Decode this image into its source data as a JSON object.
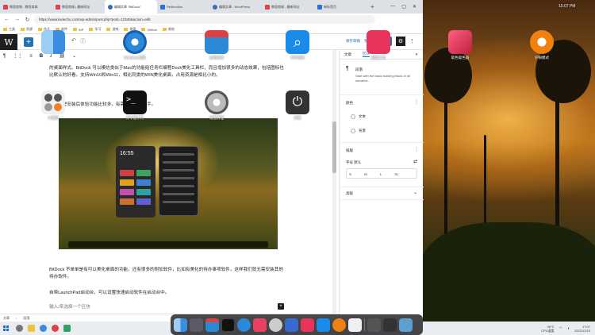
{
  "browser": {
    "tabs": [
      {
        "label": "教程商城 - 教程商城"
      },
      {
        "label": "教程商城 | 最新网址"
      },
      {
        "label": "编辑文章 “BitDock”"
      },
      {
        "label": "Redirection"
      },
      {
        "label": "编辑文章 - WordPress"
      },
      {
        "label": "教程商城 - 最新网址"
      },
      {
        "label": "新标签页"
      }
    ],
    "url": "https://www.kwiechu.com/wp-admin/post.php?post=12345&action=edit",
    "bookmarks": [
      "工具",
      "资源",
      "作品",
      "软件",
      "WP",
      "学习",
      "游戏",
      "常用",
      "GitHub",
      "其他"
    ]
  },
  "editor": {
    "save_draft": "保存草稿",
    "preview": "预览",
    "publish": "发布",
    "para1": "的桌面样式。BitDock 可以模仿类似于Mac的功能给任务栏编程Dock美化工具栏，而且增加很多的动态效果，包括图标也比默认的好看。支持Win10和Win11，相比同类的WIN美化桌面，占用资源是相比小的。",
    "para2": "这款小虎安装后体验功能比较多，有需要的可以入手。",
    "para3": "BitDock 不单单是有可以美化桌面的功能，还有很多的附加软件，比如有美化的待办事项软件，这样我们就无需安装其他待办软件。",
    "para4": "自带LaunchPad启动台，可以设置快速启动软件在启动台中。",
    "placeholder": "输入/来选择一个区块",
    "breadcrumb": [
      "文章",
      "段落"
    ],
    "phone_clock": "16:55"
  },
  "sidebar": {
    "tabs": [
      "文章",
      "区块"
    ],
    "close": "✕",
    "block_name": "段落",
    "block_desc": "Start with the basic building block of all narrative.",
    "color_title": "颜色",
    "color_text": "文本",
    "color_bg": "背景",
    "typography_title": "排版",
    "size_label": "字号 默认",
    "sizes": [
      "S",
      "M",
      "L",
      "XL"
    ],
    "advanced_title": "高级"
  },
  "desktop": {
    "icons": [
      {
        "name": "finder",
        "label": "",
        "color": "#3b8de0"
      },
      {
        "name": "windows-settings",
        "label": "Windows设置",
        "color": "#2a8ad8"
      },
      {
        "name": "store",
        "label": "应用商店",
        "color": "#1a7ad0"
      },
      {
        "name": "search",
        "label": "文件搜索",
        "color": "#1a8be8"
      },
      {
        "name": "screenshot",
        "label": "截图工具",
        "color": "#e8345a"
      },
      {
        "name": "color-picker",
        "label": "取色吸色器",
        "color": "#e84060"
      },
      {
        "name": "theme",
        "label": "护眼模式",
        "color": "#f08010"
      },
      {
        "name": "calculator",
        "label": "计算器",
        "color": "#f0f0f0"
      },
      {
        "name": "terminal",
        "label": "命令提示符",
        "color": "#111111"
      },
      {
        "name": "cleanup",
        "label": "磁盘清理",
        "color": "#d0d0d0"
      },
      {
        "name": "power",
        "label": "关机",
        "color": "#333333"
      }
    ],
    "clock": "15:07 PM"
  },
  "taskbar": {
    "weather": "49°C",
    "weather_sub": "CPU温度",
    "time": "17:07",
    "date": "2022/12/10"
  }
}
